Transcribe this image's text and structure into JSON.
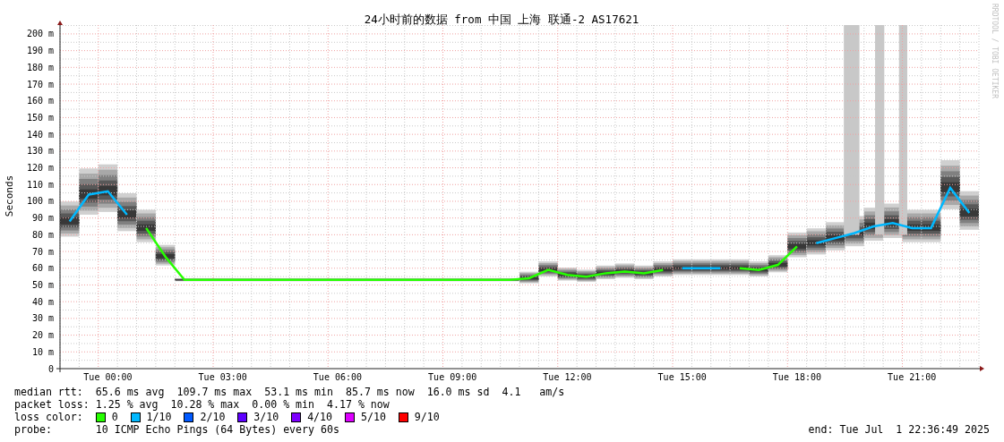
{
  "graph": {
    "title": "24小时前的数据 from 中国 上海 联通-2 AS17621",
    "watermark": "RRDTOOL / TOBI OETIKER",
    "chart_data": {
      "type": "line",
      "ylabel": "Seconds",
      "ylim": [
        0,
        205.3
      ],
      "grid": true,
      "categories": [
        null,
        null,
        "Tue 00:00",
        null,
        null,
        null,
        null,
        null,
        "Tue 03:00",
        null,
        null,
        null,
        null,
        null,
        "Tue 06:00",
        null,
        null,
        null,
        null,
        null,
        "Tue 09:00",
        null,
        null,
        null,
        null,
        null,
        "Tue 12:00",
        null,
        null,
        null,
        null,
        null,
        "Tue 15:00",
        null,
        null,
        null,
        null,
        null,
        "Tue 18:00",
        null,
        null,
        null,
        null,
        null,
        "Tue 21:00",
        null,
        null,
        null
      ],
      "series": [
        {
          "name": "0",
          "color": "#26ff00",
          "values": [
            null,
            null,
            null,
            null,
            84,
            67,
            53,
            53,
            53,
            53,
            53,
            53,
            53,
            53,
            53,
            53,
            53,
            53,
            53,
            53,
            53,
            53,
            53,
            53,
            54,
            59,
            56,
            55,
            57,
            58,
            57,
            59,
            null,
            null,
            null,
            60,
            59,
            62,
            73,
            null,
            null,
            null,
            null,
            null,
            null,
            null,
            null,
            null
          ]
        },
        {
          "name": "1/10",
          "color": "#00b8ff",
          "values": [
            88,
            104,
            106,
            92,
            null,
            null,
            null,
            null,
            null,
            null,
            null,
            null,
            null,
            null,
            null,
            null,
            null,
            null,
            null,
            null,
            null,
            null,
            null,
            null,
            null,
            null,
            null,
            null,
            null,
            null,
            null,
            null,
            60,
            60,
            60,
            null,
            null,
            null,
            null,
            75,
            78,
            81,
            85,
            87,
            84,
            84,
            108,
            93
          ]
        },
        {
          "name": "2/10",
          "color": "#0059ff",
          "values": [
            null,
            null,
            null,
            null,
            null,
            null,
            null,
            null,
            null,
            null,
            null,
            null,
            null,
            null,
            null,
            null,
            null,
            null,
            null,
            null,
            null,
            null,
            null,
            null,
            null,
            null,
            null,
            null,
            null,
            null,
            null,
            null,
            null,
            null,
            null,
            null,
            null,
            null,
            null,
            null,
            null,
            null,
            null,
            null,
            null,
            null,
            null,
            null
          ]
        },
        {
          "name": "3/10",
          "color": "#5e00ff",
          "values": [
            null,
            null,
            null,
            null,
            null,
            null,
            null,
            null,
            null,
            null,
            null,
            null,
            null,
            null,
            null,
            null,
            null,
            null,
            null,
            null,
            null,
            null,
            null,
            null,
            null,
            null,
            null,
            null,
            null,
            null,
            null,
            null,
            null,
            null,
            null,
            null,
            null,
            null,
            null,
            null,
            null,
            null,
            null,
            null,
            null,
            null,
            null,
            null
          ]
        },
        {
          "name": "4/10",
          "color": "#7e00ff",
          "values": [
            null,
            null,
            null,
            null,
            null,
            null,
            null,
            null,
            null,
            null,
            null,
            null,
            null,
            null,
            null,
            null,
            null,
            null,
            null,
            null,
            null,
            null,
            null,
            null,
            null,
            null,
            null,
            null,
            null,
            null,
            null,
            null,
            null,
            null,
            null,
            null,
            null,
            null,
            null,
            null,
            null,
            null,
            null,
            null,
            null,
            null,
            null,
            null
          ]
        },
        {
          "name": "5/10",
          "color": "#dd00ff",
          "values": [
            null,
            null,
            null,
            null,
            null,
            null,
            null,
            null,
            null,
            null,
            null,
            null,
            null,
            null,
            null,
            null,
            null,
            null,
            null,
            null,
            null,
            null,
            null,
            null,
            null,
            null,
            null,
            null,
            null,
            null,
            null,
            null,
            null,
            null,
            null,
            null,
            null,
            null,
            null,
            null,
            null,
            null,
            null,
            null,
            null,
            null,
            null,
            null
          ]
        },
        {
          "name": "9/10",
          "color": "#ff0000",
          "values": [
            null,
            null,
            null,
            null,
            null,
            null,
            null,
            null,
            null,
            null,
            null,
            null,
            null,
            null,
            null,
            null,
            null,
            null,
            null,
            null,
            null,
            null,
            null,
            null,
            null,
            null,
            null,
            null,
            null,
            null,
            null,
            null,
            null,
            null,
            null,
            null,
            null,
            null,
            null,
            null,
            null,
            null,
            null,
            null,
            null,
            null,
            null,
            null
          ]
        }
      ],
      "yticks": [
        {
          "value": 0,
          "label": "0"
        },
        {
          "value": 10,
          "label": "10 m"
        },
        {
          "value": 20,
          "label": "20 m"
        },
        {
          "value": 30,
          "label": "30 m"
        },
        {
          "value": 40,
          "label": "40 m"
        },
        {
          "value": 50,
          "label": "50 m"
        },
        {
          "value": 60,
          "label": "60 m"
        },
        {
          "value": 70,
          "label": "70 m"
        },
        {
          "value": 80,
          "label": "80 m"
        },
        {
          "value": 90,
          "label": "90 m"
        },
        {
          "value": 100,
          "label": "100 m"
        },
        {
          "value": 110,
          "label": "110 m"
        },
        {
          "value": 120,
          "label": "120 m"
        },
        {
          "value": 130,
          "label": "130 m"
        },
        {
          "value": 140,
          "label": "140 m"
        },
        {
          "value": 150,
          "label": "150 m"
        },
        {
          "value": 160,
          "label": "160 m"
        },
        {
          "value": 170,
          "label": "170 m"
        },
        {
          "value": 180,
          "label": "180 m"
        },
        {
          "value": 190,
          "label": "190 m"
        },
        {
          "value": 200,
          "label": "200 m"
        }
      ]
    }
  },
  "stats": [
    {
      "label": "median rtt:",
      "text": "65.6 ms avg  109.7 ms max  53.1 ms min  85.7 ms now  16.0 ms sd  4.1   am/s"
    },
    {
      "label": "packet loss:",
      "text": "1.25 % avg  10.28 % max  0.00 % min  4.17 % now"
    }
  ],
  "loss_legend": {
    "label": "loss color:"
  },
  "probe": {
    "label": "probe:",
    "text": "10 ICMP Echo Pings (64 Bytes) every 60s"
  },
  "end": "end: Tue Jul  1 22:36:49 2025"
}
